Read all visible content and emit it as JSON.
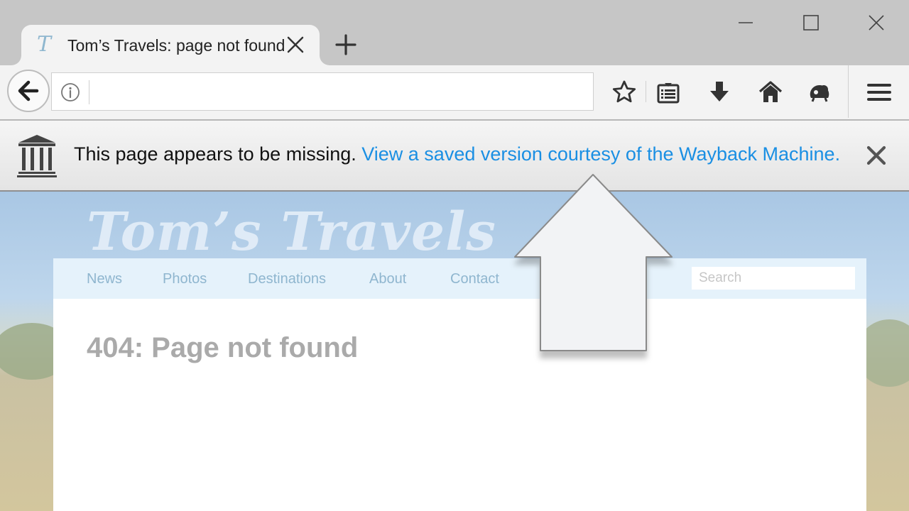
{
  "browser": {
    "tab": {
      "title": "Tom’s Travels: page not found",
      "favicon": "T"
    },
    "window_controls": [
      "minimize-icon",
      "maximize-icon",
      "close-icon"
    ],
    "url": {
      "value": "",
      "placeholder": ""
    },
    "toolbar_icons": [
      "bookmark-star-icon",
      "reading-list-icon",
      "download-icon",
      "home-icon",
      "extension-icon",
      "menu-icon"
    ]
  },
  "notification": {
    "text": "This page appears to be missing.",
    "link": "View a saved version courtesy of the Wayback Machine.",
    "icon": "archive-icon"
  },
  "site": {
    "logo": "Tom’s Travels",
    "nav": [
      "News",
      "Photos",
      "Destinations",
      "About",
      "Contact"
    ],
    "search_placeholder": "Search",
    "heading": "404: Page not found"
  },
  "colors": {
    "link": "#1a8fe3",
    "tab_bg": "#f3f3f3",
    "titlebar_bg": "#c6c6c6",
    "site_nav_bg": "#e5f2fb",
    "site_nav_text": "#8fb6cf",
    "heading_text": "#aaaaaa"
  }
}
